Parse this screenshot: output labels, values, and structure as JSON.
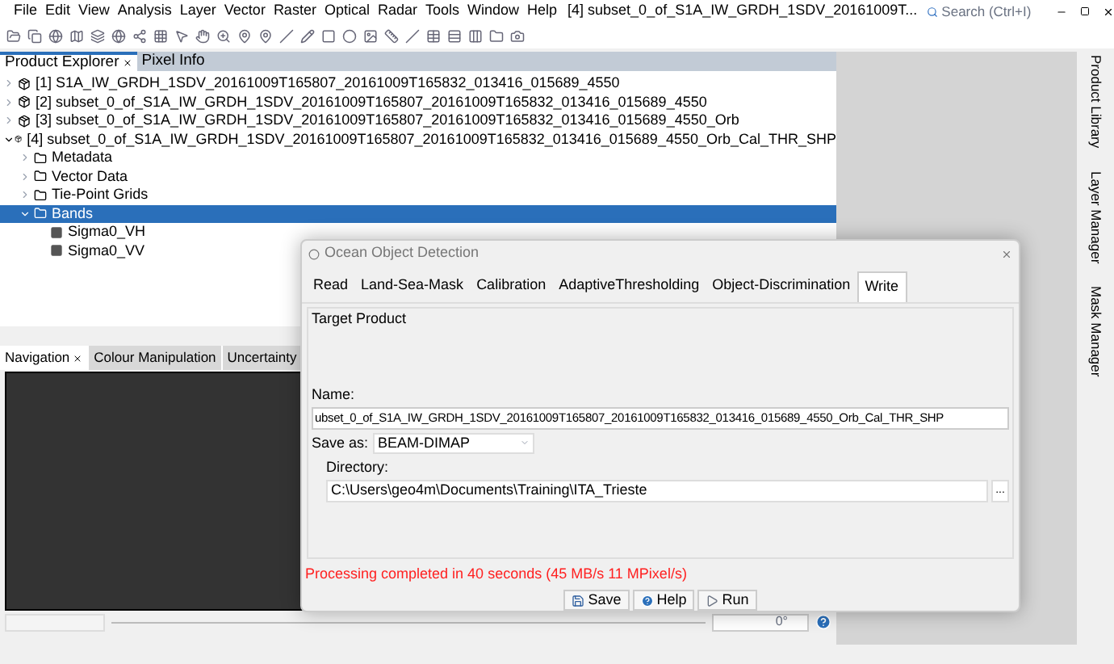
{
  "menu": [
    "File",
    "Edit",
    "View",
    "Analysis",
    "Layer",
    "Vector",
    "Raster",
    "Optical",
    "Radar",
    "Tools",
    "Window",
    "Help"
  ],
  "window_title": "[4] subset_0_of_S1A_IW_GRDH_1SDV_20161009T...",
  "search": {
    "placeholder": "Search (Ctrl+I)"
  },
  "explorer_tabs": [
    {
      "label": "Product Explorer",
      "selected": true
    },
    {
      "label": "Pixel Info",
      "selected": false
    }
  ],
  "tree": [
    {
      "label": "[1] S1A_IW_GRDH_1SDV_20161009T165807_20161009T165832_013416_015689_4550",
      "kind": "product",
      "expanded": false,
      "selected": false
    },
    {
      "label": "[2] subset_0_of_S1A_IW_GRDH_1SDV_20161009T165807_20161009T165832_013416_015689_4550",
      "kind": "product",
      "expanded": false,
      "selected": false
    },
    {
      "label": "[3] subset_0_of_S1A_IW_GRDH_1SDV_20161009T165807_20161009T165832_013416_015689_4550_Orb",
      "kind": "product",
      "expanded": false,
      "selected": false
    },
    {
      "label": "[4] subset_0_of_S1A_IW_GRDH_1SDV_20161009T165807_20161009T165832_013416_015689_4550_Orb_Cal_THR_SHP",
      "kind": "product",
      "expanded": true,
      "selected": false,
      "children": [
        {
          "label": "Metadata",
          "kind": "folder",
          "expanded": false,
          "selected": false
        },
        {
          "label": "Vector Data",
          "kind": "folder",
          "expanded": false,
          "selected": false
        },
        {
          "label": "Tie-Point Grids",
          "kind": "folder",
          "expanded": false,
          "selected": false
        },
        {
          "label": "Bands",
          "kind": "folder",
          "expanded": true,
          "selected": true,
          "children": [
            {
              "label": "Sigma0_VH",
              "kind": "band",
              "selected": false
            },
            {
              "label": "Sigma0_VV",
              "kind": "band",
              "selected": false
            }
          ]
        }
      ]
    }
  ],
  "nav_tabs": [
    {
      "label": "Navigation",
      "selected": true
    },
    {
      "label": "Colour Manipulation",
      "selected": false
    },
    {
      "label": "Uncertainty",
      "selected": false
    }
  ],
  "nav_angle": "0°",
  "side_tabs": [
    "Product Library",
    "Layer Manager",
    "Mask Manager"
  ],
  "dialog": {
    "title": "Ocean Object Detection",
    "tabs": [
      {
        "label": "Read",
        "selected": false
      },
      {
        "label": "Land-Sea-Mask",
        "selected": false
      },
      {
        "label": "Calibration",
        "selected": false
      },
      {
        "label": "AdaptiveThresholding",
        "selected": false
      },
      {
        "label": "Object-Discrimination",
        "selected": false
      },
      {
        "label": "Write",
        "selected": true
      }
    ],
    "section": "Target Product",
    "name_label": "Name:",
    "name_value": "ubset_0_of_S1A_IW_GRDH_1SDV_20161009T165807_20161009T165832_013416_015689_4550_Orb_Cal_THR_SHP",
    "save_as_label": "Save as:",
    "save_as_value": "BEAM-DIMAP",
    "directory_label": "Directory:",
    "directory_value": "C:\\Users\\geo4m\\Documents\\Training\\ITA_Trieste",
    "browse": "...",
    "status": "Processing completed in 40 seconds (45 MB/s 11 MPixel/s)",
    "buttons": [
      {
        "label": "Save",
        "kind": "save"
      },
      {
        "label": "Help",
        "kind": "help"
      },
      {
        "label": "Run",
        "kind": "run"
      }
    ]
  }
}
